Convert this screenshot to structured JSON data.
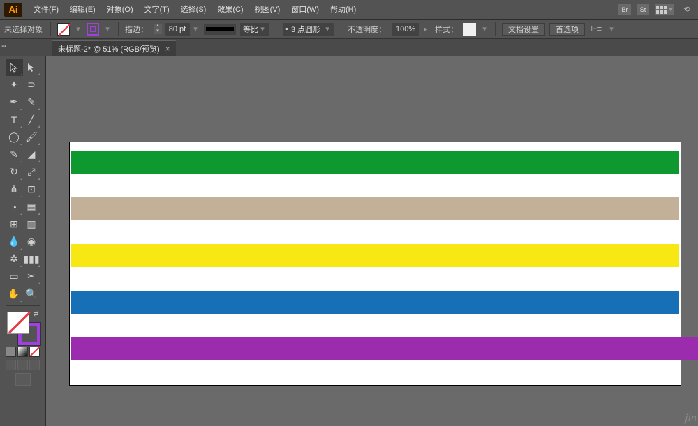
{
  "app": {
    "logo": "Ai"
  },
  "menubar": {
    "items": [
      "文件(F)",
      "编辑(E)",
      "对象(O)",
      "文字(T)",
      "选择(S)",
      "效果(C)",
      "视图(V)",
      "窗口(W)",
      "帮助(H)"
    ],
    "br": "Br",
    "st": "St"
  },
  "controlbar": {
    "selection": "未选择对象",
    "stroke_label": "描边：",
    "stroke_size": "80 pt",
    "uniform": "等比",
    "dash_label": "3 点圆形",
    "opacity_label": "不透明度：",
    "opacity_value": "100%",
    "style_label": "样式：",
    "doc_setup": "文档设置",
    "prefs": "首选项"
  },
  "tab": {
    "title": "未标题-2* @ 51% (RGB/预览)"
  },
  "watermark": "jin"
}
